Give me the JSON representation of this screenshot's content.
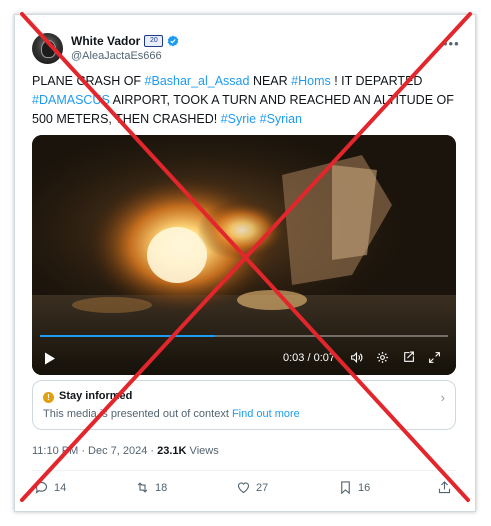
{
  "author": {
    "display_name": "White Vador",
    "badge_text": "20",
    "handle": "@AleaJactaEs666"
  },
  "tweet": {
    "t1": "PLANE CRASH OF ",
    "h1": "#Bashar_al_Assad",
    "t2": "  NEAR ",
    "h2": "#Homs",
    "t3": " ! IT DEPARTED ",
    "h3": "#DAMASCUS",
    "t4": " AIRPORT, TOOK A TURN AND REACHED AN ALTITUDE OF 500 METERS, THEN CRASHED! ",
    "h4": "#Syrie",
    "t5": " ",
    "h5": "#Syrian"
  },
  "video": {
    "time_display": "0:03 / 0:07",
    "progress_fraction": 0.43
  },
  "notice": {
    "title": "Stay informed",
    "icon_text": "!",
    "body": "This media is presented out of context ",
    "link": "Find out more"
  },
  "meta": {
    "timestamp": "11:10 PM · Dec 7, 2024 · ",
    "views_count": "23.1K",
    "views_label": " Views"
  },
  "actions": {
    "replies": "14",
    "reposts": "18",
    "likes": "27",
    "bookmarks": "16"
  },
  "colors": {
    "accent": "#1d9bf0",
    "cross": "#e3262c",
    "notice_icon": "#e0a00f"
  }
}
